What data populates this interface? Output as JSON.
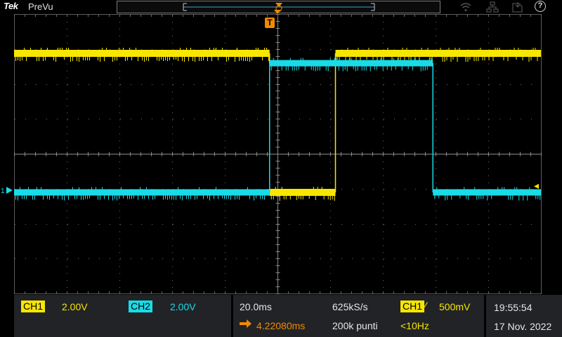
{
  "topbar": {
    "brand": "Tek",
    "mode": "PreVu"
  },
  "icons": {
    "wifi": "wifi-icon",
    "network": "network-icon",
    "save": "save-icon",
    "help": "help-icon",
    "help_glyph": "?"
  },
  "colors": {
    "ch1": "#f7e600",
    "ch2": "#19dbe8",
    "trigger": "#f08a00",
    "panel": "#222327",
    "grid": "#6f6f6f"
  },
  "trigger_marker": {
    "label": "T"
  },
  "markers": {
    "ch2_ground": "1",
    "ch1_level": "◂"
  },
  "traces": {
    "ch1": {
      "name": "CH1",
      "levels": [
        "high",
        "low",
        "high"
      ],
      "edges_div": [
        4.85,
        6.1
      ]
    },
    "ch2": {
      "name": "CH2",
      "levels": [
        "low",
        "high",
        "low"
      ],
      "edges_div": [
        4.85,
        7.95
      ]
    }
  },
  "bottom": {
    "ch1": {
      "label": "CH1",
      "scale": "2.00V"
    },
    "ch2": {
      "label": "CH2",
      "scale": "2.00V"
    },
    "horizontal": {
      "timebase": "20.0ms",
      "sample_rate": "625kS/s",
      "delay": "4.22080ms",
      "record_length": "200k punti"
    },
    "trigger": {
      "source": "CH1",
      "slope_glyph": "⁄",
      "level": "500mV",
      "frequency": "<10Hz"
    },
    "clock": {
      "time": "19:55:54",
      "date": "17 Nov. 2022"
    }
  }
}
